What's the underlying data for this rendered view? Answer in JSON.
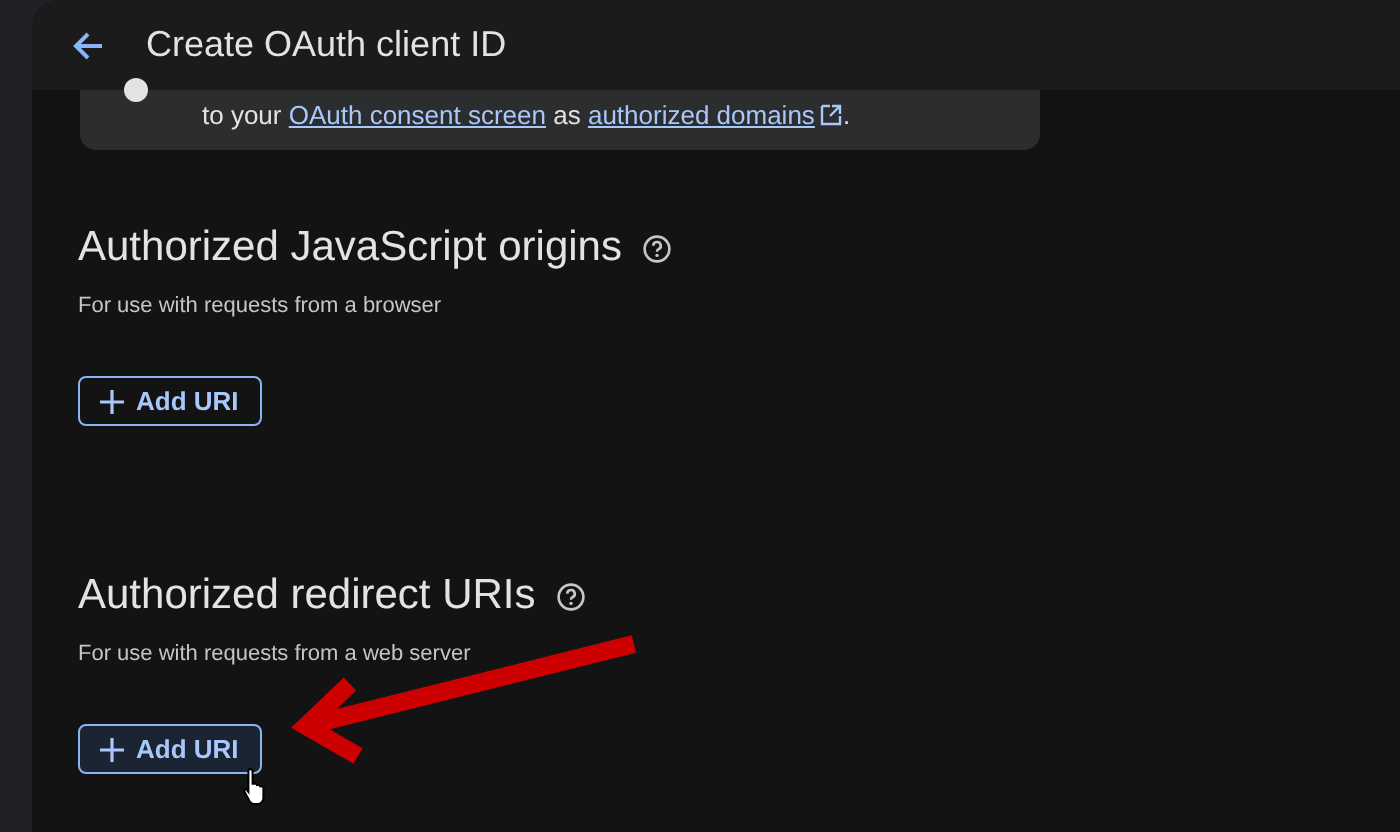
{
  "header": {
    "title": "Create OAuth client ID"
  },
  "note": {
    "segments": [
      {
        "kind": "text",
        "text": "to your "
      },
      {
        "kind": "link",
        "text": "OAuth consent screen"
      },
      {
        "kind": "text",
        "text": " as "
      },
      {
        "kind": "external",
        "text": "authorized domains"
      },
      {
        "kind": "text",
        "text": "."
      }
    ]
  },
  "sections": [
    {
      "heading": "Authorized JavaScript origins",
      "hint": "For use with requests from a browser",
      "button": "Add URI",
      "highlighted": false
    },
    {
      "heading": "Authorized redirect URIs",
      "hint": "For use with requests from a web server",
      "button": "Add URI",
      "highlighted": true
    }
  ]
}
